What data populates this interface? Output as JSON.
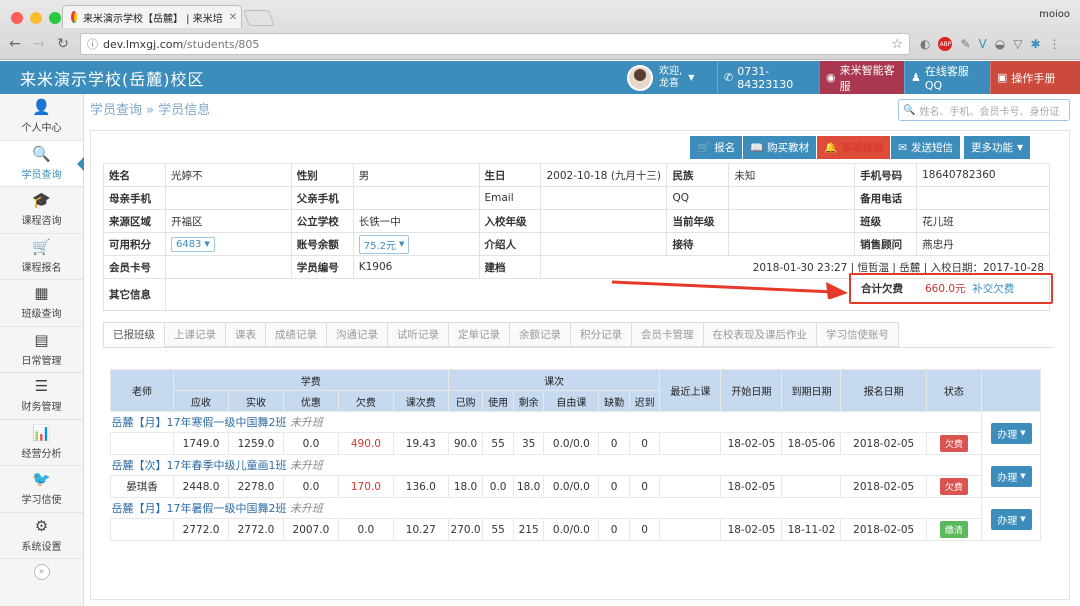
{
  "browser": {
    "tab_title": "来米演示学校【岳麓】 | 来米培",
    "url_host": "dev.lmxgj.com",
    "url_path": "/students/805",
    "profile": "moioo"
  },
  "topbar": {
    "brand": "来米演示学校(岳麓)校区",
    "welcome": "欢迎,",
    "user": "龙喜",
    "phone": "0731-84323130",
    "service": "来米智能客服",
    "qq": "在线客服QQ",
    "manual": "操作手册"
  },
  "sidebar": [
    {
      "icon": "👤",
      "label": "个人中心"
    },
    {
      "icon": "🔍",
      "label": "学员查询"
    },
    {
      "icon": "🎓",
      "label": "课程咨询"
    },
    {
      "icon": "🛒",
      "label": "课程报名"
    },
    {
      "icon": "▦",
      "label": "班级查询"
    },
    {
      "icon": "▤",
      "label": "日常管理"
    },
    {
      "icon": "☰",
      "label": "财务管理"
    },
    {
      "icon": "📊",
      "label": "经营分析"
    },
    {
      "icon": "🐦",
      "label": "学习信使"
    },
    {
      "icon": "⚙",
      "label": "系统设置"
    }
  ],
  "breadcrumb": {
    "a": "学员查询",
    "sep": "»",
    "b": "学员信息"
  },
  "search": {
    "placeholder": "姓名、手机、会员卡号、身份证"
  },
  "actions": {
    "signup": "报名",
    "buy": "购买教材",
    "remind": "事项提醒",
    "sms": "发送短信",
    "more": "更多功能"
  },
  "info": {
    "r1": [
      "姓名",
      "光婷不",
      "性别",
      "男",
      "生日",
      "2002-10-18 (九月十三)",
      "民族",
      "未知",
      "手机号码",
      "18640782360"
    ],
    "r2": [
      "母亲手机",
      "",
      "父亲手机",
      "",
      "Email",
      "",
      "QQ",
      "",
      "备用电话",
      ""
    ],
    "r3": [
      "来源区域",
      "开福区",
      "公立学校",
      "长铁一中",
      "入校年级",
      "",
      "当前年级",
      "",
      "班级",
      "花儿班"
    ],
    "r4": [
      "可用积分",
      "6483",
      "账号余额",
      "75.2元",
      "介绍人",
      "",
      "接待",
      "",
      "销售顾问",
      "燕忠丹"
    ],
    "r5": [
      "会员卡号",
      "",
      "学员编号",
      "K1906",
      "建档",
      "2018-01-30 23:27 | 恒哲温 | 岳麓 | 入校日期：2017-10-28"
    ],
    "r6": [
      "其它信息"
    ],
    "owe_label": "合计欠费",
    "owe_amount": "660.0元",
    "owe_link": "补交欠费"
  },
  "tabs": [
    "已报班级",
    "上课记录",
    "课表",
    "成绩记录",
    "沟通记录",
    "试听记录",
    "定单记录",
    "余额记录",
    "积分记录",
    "会员卡管理",
    "在校表现及课后作业",
    "学习信使账号"
  ],
  "grid": {
    "h1": {
      "teacher": "老师",
      "fee": "学费",
      "lesson": "课次",
      "last": "最近上课",
      "start": "开始日期",
      "end": "到期日期",
      "enroll": "报名日期",
      "status": "状态"
    },
    "h2": [
      "应收",
      "实收",
      "优惠",
      "欠费",
      "课次费",
      "已购",
      "使用",
      "剩余",
      "自由课",
      "缺勤",
      "迟到"
    ],
    "courses": [
      {
        "title": "岳麓【月】17年寒假一级中国舞2班",
        "tag": "未升班",
        "row": [
          "",
          "1749.0",
          "1259.0",
          "0.0",
          "490.0",
          "19.43",
          "90.0",
          "55",
          "35",
          "0.0/0.0",
          "0",
          "0",
          "",
          "18-02-05",
          "18-05-06",
          "2018-02-05"
        ],
        "status": "欠费",
        "action": "办理"
      },
      {
        "title": "岳麓【次】17年春季中级儿童画1班",
        "tag": "未升班",
        "row": [
          "晏琪香",
          "2448.0",
          "2278.0",
          "0.0",
          "170.0",
          "136.0",
          "18.0",
          "0.0",
          "18.0",
          "0.0/0.0",
          "0",
          "0",
          "",
          "18-02-05",
          "",
          "2018-02-05"
        ],
        "status": "欠费",
        "action": "办理"
      },
      {
        "title": "岳麓【月】17年暑假一级中国舞2班",
        "tag": "未升班",
        "row": [
          "",
          "2772.0",
          "2772.0",
          "2007.0",
          "0.0",
          "10.27",
          "270.0",
          "55",
          "215",
          "0.0/0.0",
          "0",
          "0",
          "",
          "18-02-05",
          "18-11-02",
          "2018-02-05"
        ],
        "status": "缴清",
        "action": "办理"
      }
    ]
  }
}
